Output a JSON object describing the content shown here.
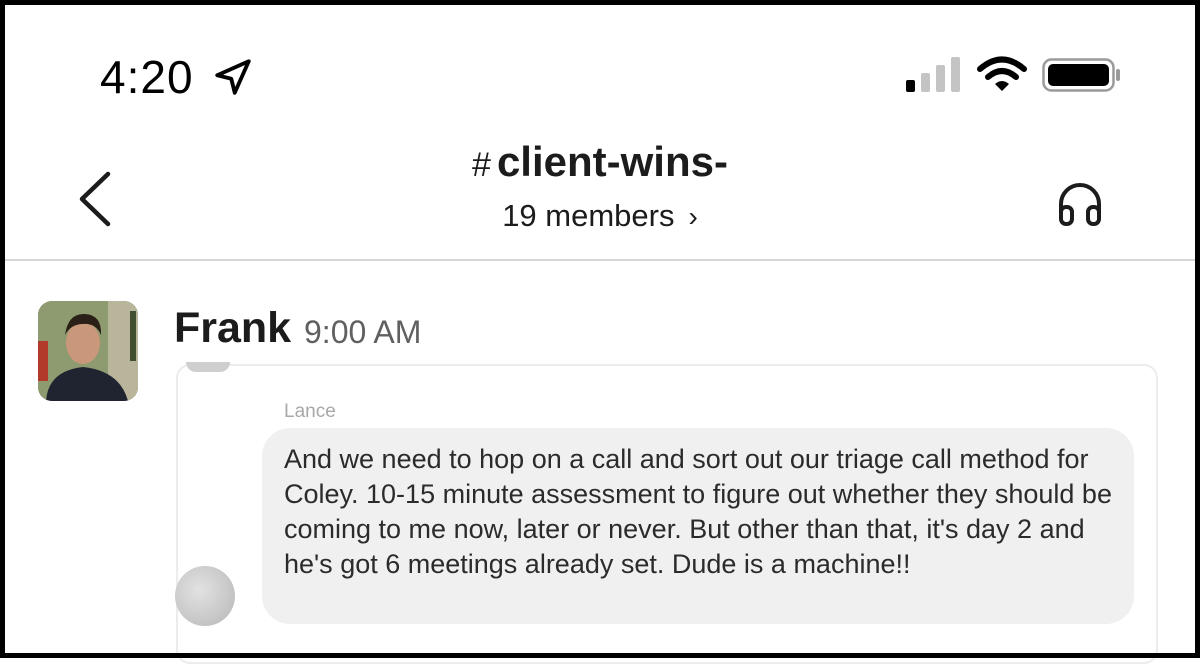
{
  "status_bar": {
    "time": "4:20",
    "icons": [
      "location-arrow-icon",
      "cellular-signal-icon",
      "wifi-icon",
      "battery-icon"
    ]
  },
  "header": {
    "channel_prefix": "#",
    "channel_name": "client-wins-",
    "members_label": "19 members",
    "members_chevron": "›",
    "back_icon": "chevron-left-icon",
    "huddle_icon": "headphones-icon"
  },
  "message": {
    "author": "Frank",
    "time": "9:00 AM",
    "shared": {
      "sender": "Lance",
      "text": "And we need to hop on a call and sort out our triage call method for Coley. 10-15 minute assessment to figure out whether they should be coming to me now, later or never. But other than that, it's day 2 and he's got 6 meetings already set. Dude is a machine!!"
    }
  },
  "colors": {
    "text": "#1d1c1d",
    "muted": "#616061",
    "bubble": "#f0f0f0",
    "divider": "#d6d6d6"
  }
}
